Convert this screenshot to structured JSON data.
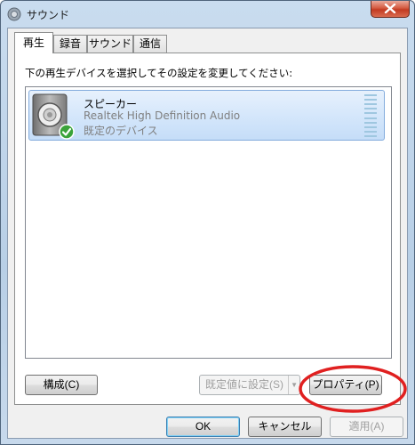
{
  "window": {
    "title": "サウンド",
    "close_label": "✕"
  },
  "tabs": [
    {
      "label": "再生",
      "active": true
    },
    {
      "label": "録音",
      "active": false
    },
    {
      "label": "サウンド",
      "active": false
    },
    {
      "label": "通信",
      "active": false
    }
  ],
  "playback": {
    "instruction": "下の再生デバイスを選択してその設定を変更してください:",
    "devices": [
      {
        "name": "スピーカー",
        "description": "Realtek High Definition Audio",
        "status": "既定のデバイス",
        "icon": "speaker-icon",
        "default_badge_icon": "check-icon",
        "selected": true,
        "level_meter_segments": 10
      }
    ]
  },
  "buttons": {
    "configure": "構成(C)",
    "set_default": "既定値に設定(S)",
    "set_default_menu": "▼",
    "properties": "プロパティ(P)",
    "ok": "OK",
    "cancel": "キャンセル",
    "apply": "適用(A)"
  },
  "colors": {
    "selection": "#cce4fb",
    "highlight_circle": "#e02020",
    "close_button": "#c94a32"
  }
}
